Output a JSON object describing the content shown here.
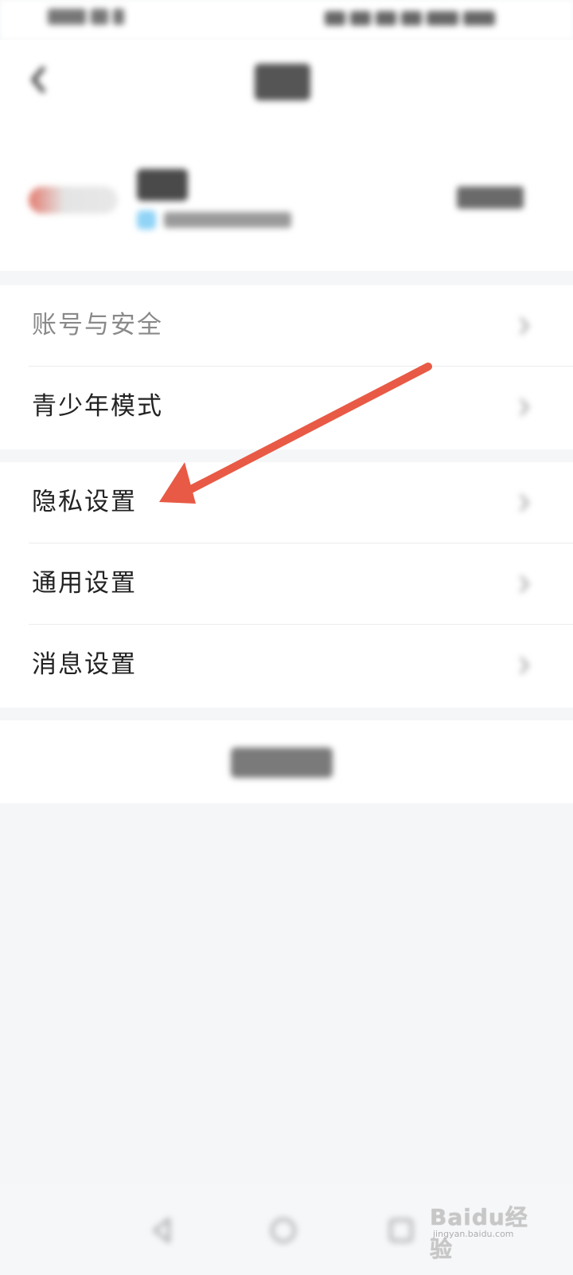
{
  "menu": {
    "group1": [
      {
        "label": "账号与安全"
      },
      {
        "label": "青少年模式"
      }
    ],
    "group2": [
      {
        "label": "隐私设置"
      },
      {
        "label": "通用设置"
      },
      {
        "label": "消息设置"
      }
    ]
  },
  "annotation": {
    "arrow_color": "#e85a45",
    "points_to": "隐私设置"
  },
  "watermark": {
    "brand": "Baidu经验",
    "url": "jingyan.baidu.com"
  },
  "colors": {
    "background": "#f5f6f8",
    "card": "#ffffff",
    "text_primary": "#222222",
    "text_muted": "#8a8a8a"
  }
}
